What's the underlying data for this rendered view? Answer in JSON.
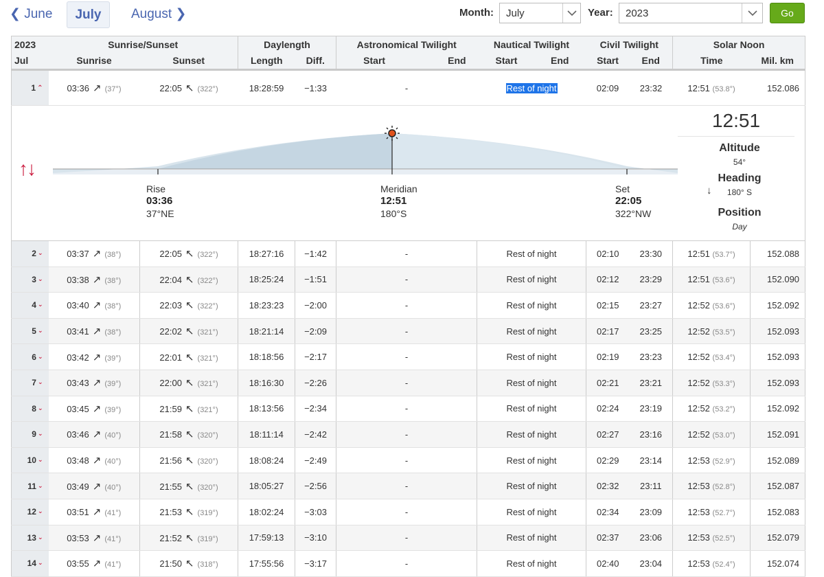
{
  "nav": {
    "prev": "June",
    "current": "July",
    "next": "August"
  },
  "controls": {
    "month_label": "Month:",
    "month_value": "July",
    "year_label": "Year:",
    "year_value": "2023",
    "go_label": "Go"
  },
  "header": {
    "year": "2023",
    "month_abbr": "Jul",
    "groups": {
      "sunrise_sunset": "Sunrise/Sunset",
      "daylength": "Daylength",
      "astro": "Astronomical Twilight",
      "nautical": "Nautical Twilight",
      "civil": "Civil Twilight",
      "noon": "Solar Noon"
    },
    "cols": {
      "sunrise": "Sunrise",
      "sunset": "Sunset",
      "length": "Length",
      "diff": "Diff.",
      "start": "Start",
      "end": "End",
      "time": "Time",
      "milkm": "Mil. km"
    }
  },
  "detail": {
    "rise_label": "Rise",
    "rise_time": "03:36",
    "rise_dir": "37°NE",
    "meridian_label": "Meridian",
    "meridian_time": "12:51",
    "meridian_dir": "180°S",
    "set_label": "Set",
    "set_time": "22:05",
    "set_dir": "322°NW",
    "noon_time": "12:51",
    "altitude_label": "Altitude",
    "altitude_value": "54°",
    "heading_label": "Heading",
    "heading_value": "180° S",
    "position_label": "Position",
    "position_value": "Day"
  },
  "rows": [
    {
      "day": "1",
      "rise": "03:36",
      "rise_az": "(37°)",
      "set": "22:05",
      "set_az": "(322°)",
      "len": "18:28:59",
      "diff": "−1:33",
      "astro": "-",
      "naut": "Rest of night",
      "civ_s": "02:09",
      "civ_e": "23:32",
      "noon": "12:51",
      "noon_alt": "(53.8°)",
      "km": "152.086"
    },
    {
      "day": "2",
      "rise": "03:37",
      "rise_az": "(38°)",
      "set": "22:05",
      "set_az": "(322°)",
      "len": "18:27:16",
      "diff": "−1:42",
      "astro": "-",
      "naut": "Rest of night",
      "civ_s": "02:10",
      "civ_e": "23:30",
      "noon": "12:51",
      "noon_alt": "(53.7°)",
      "km": "152.088"
    },
    {
      "day": "3",
      "rise": "03:38",
      "rise_az": "(38°)",
      "set": "22:04",
      "set_az": "(322°)",
      "len": "18:25:24",
      "diff": "−1:51",
      "astro": "-",
      "naut": "Rest of night",
      "civ_s": "02:12",
      "civ_e": "23:29",
      "noon": "12:51",
      "noon_alt": "(53.6°)",
      "km": "152.090"
    },
    {
      "day": "4",
      "rise": "03:40",
      "rise_az": "(38°)",
      "set": "22:03",
      "set_az": "(322°)",
      "len": "18:23:23",
      "diff": "−2:00",
      "astro": "-",
      "naut": "Rest of night",
      "civ_s": "02:15",
      "civ_e": "23:27",
      "noon": "12:52",
      "noon_alt": "(53.6°)",
      "km": "152.092"
    },
    {
      "day": "5",
      "rise": "03:41",
      "rise_az": "(38°)",
      "set": "22:02",
      "set_az": "(321°)",
      "len": "18:21:14",
      "diff": "−2:09",
      "astro": "-",
      "naut": "Rest of night",
      "civ_s": "02:17",
      "civ_e": "23:25",
      "noon": "12:52",
      "noon_alt": "(53.5°)",
      "km": "152.093"
    },
    {
      "day": "6",
      "rise": "03:42",
      "rise_az": "(39°)",
      "set": "22:01",
      "set_az": "(321°)",
      "len": "18:18:56",
      "diff": "−2:17",
      "astro": "-",
      "naut": "Rest of night",
      "civ_s": "02:19",
      "civ_e": "23:23",
      "noon": "12:52",
      "noon_alt": "(53.4°)",
      "km": "152.093"
    },
    {
      "day": "7",
      "rise": "03:43",
      "rise_az": "(39°)",
      "set": "22:00",
      "set_az": "(321°)",
      "len": "18:16:30",
      "diff": "−2:26",
      "astro": "-",
      "naut": "Rest of night",
      "civ_s": "02:21",
      "civ_e": "23:21",
      "noon": "12:52",
      "noon_alt": "(53.3°)",
      "km": "152.093"
    },
    {
      "day": "8",
      "rise": "03:45",
      "rise_az": "(39°)",
      "set": "21:59",
      "set_az": "(321°)",
      "len": "18:13:56",
      "diff": "−2:34",
      "astro": "-",
      "naut": "Rest of night",
      "civ_s": "02:24",
      "civ_e": "23:19",
      "noon": "12:52",
      "noon_alt": "(53.2°)",
      "km": "152.092"
    },
    {
      "day": "9",
      "rise": "03:46",
      "rise_az": "(40°)",
      "set": "21:58",
      "set_az": "(320°)",
      "len": "18:11:14",
      "diff": "−2:42",
      "astro": "-",
      "naut": "Rest of night",
      "civ_s": "02:27",
      "civ_e": "23:16",
      "noon": "12:52",
      "noon_alt": "(53.0°)",
      "km": "152.091"
    },
    {
      "day": "10",
      "rise": "03:48",
      "rise_az": "(40°)",
      "set": "21:56",
      "set_az": "(320°)",
      "len": "18:08:24",
      "diff": "−2:49",
      "astro": "-",
      "naut": "Rest of night",
      "civ_s": "02:29",
      "civ_e": "23:14",
      "noon": "12:53",
      "noon_alt": "(52.9°)",
      "km": "152.089"
    },
    {
      "day": "11",
      "rise": "03:49",
      "rise_az": "(40°)",
      "set": "21:55",
      "set_az": "(320°)",
      "len": "18:05:27",
      "diff": "−2:56",
      "astro": "-",
      "naut": "Rest of night",
      "civ_s": "02:32",
      "civ_e": "23:11",
      "noon": "12:53",
      "noon_alt": "(52.8°)",
      "km": "152.087"
    },
    {
      "day": "12",
      "rise": "03:51",
      "rise_az": "(41°)",
      "set": "21:53",
      "set_az": "(319°)",
      "len": "18:02:24",
      "diff": "−3:03",
      "astro": "-",
      "naut": "Rest of night",
      "civ_s": "02:34",
      "civ_e": "23:09",
      "noon": "12:53",
      "noon_alt": "(52.7°)",
      "km": "152.083"
    },
    {
      "day": "13",
      "rise": "03:53",
      "rise_az": "(41°)",
      "set": "21:52",
      "set_az": "(319°)",
      "len": "17:59:13",
      "diff": "−3:10",
      "astro": "-",
      "naut": "Rest of night",
      "civ_s": "02:37",
      "civ_e": "23:06",
      "noon": "12:53",
      "noon_alt": "(52.5°)",
      "km": "152.079"
    },
    {
      "day": "14",
      "rise": "03:55",
      "rise_az": "(41°)",
      "set": "21:50",
      "set_az": "(318°)",
      "len": "17:55:56",
      "diff": "−3:17",
      "astro": "-",
      "naut": "Rest of night",
      "civ_s": "02:40",
      "civ_e": "23:04",
      "noon": "12:53",
      "noon_alt": "(52.4°)",
      "km": "152.074"
    }
  ]
}
